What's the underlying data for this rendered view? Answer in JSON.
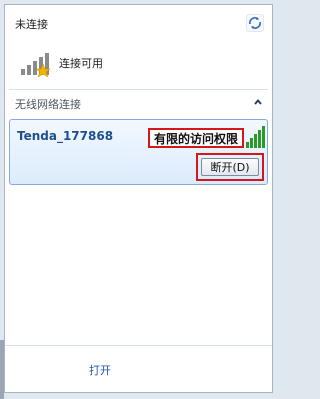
{
  "status": {
    "not_connected_label": "未连接",
    "connections_available_label": "连接可用"
  },
  "wireless_section": {
    "label": "无线网络连接"
  },
  "network": {
    "ssid": "Tenda_177868",
    "access_status": "有限的访问权限",
    "signal_bars_lit": 5,
    "signal_bars_total": 5,
    "disconnect_label": "断开(D)"
  },
  "footer": {
    "open_link_label": "打开"
  },
  "colors": {
    "highlight_box": "#d6171a",
    "ssid_text": "#1f4f8e",
    "link": "#1d5ca8",
    "signal_green": "#2c9a26"
  }
}
